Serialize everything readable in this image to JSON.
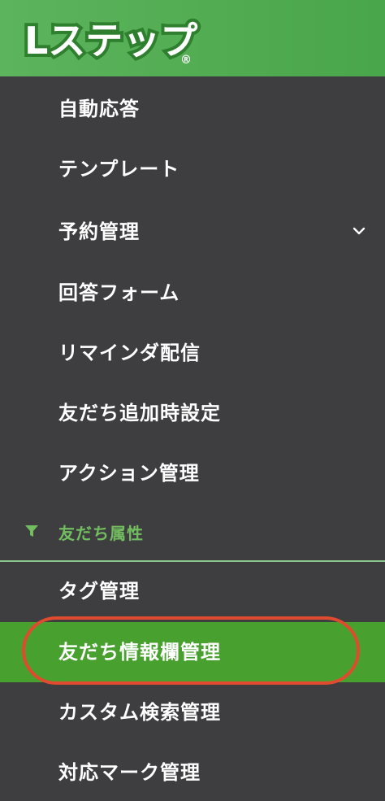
{
  "logo": {
    "text": "Lステップ",
    "registered": "®"
  },
  "menu": {
    "items": [
      {
        "label": "自動応答"
      },
      {
        "label": "テンプレート"
      },
      {
        "label": "予約管理"
      },
      {
        "label": "回答フォーム"
      },
      {
        "label": "リマインダ配信"
      },
      {
        "label": "友だち追加時設定"
      },
      {
        "label": "アクション管理"
      }
    ]
  },
  "section": {
    "label": "友だち属性",
    "items": [
      {
        "label": "タグ管理"
      },
      {
        "label": "友だち情報欄管理",
        "active": true
      },
      {
        "label": "カスタム検索管理"
      },
      {
        "label": "対応マーク管理"
      }
    ]
  },
  "colors": {
    "header": "#4ea84e",
    "sidebar_bg": "#3e3e40",
    "active_bg": "#48a12f",
    "section_label": "#71bd5f",
    "highlight_circle": "#e04a2f"
  }
}
